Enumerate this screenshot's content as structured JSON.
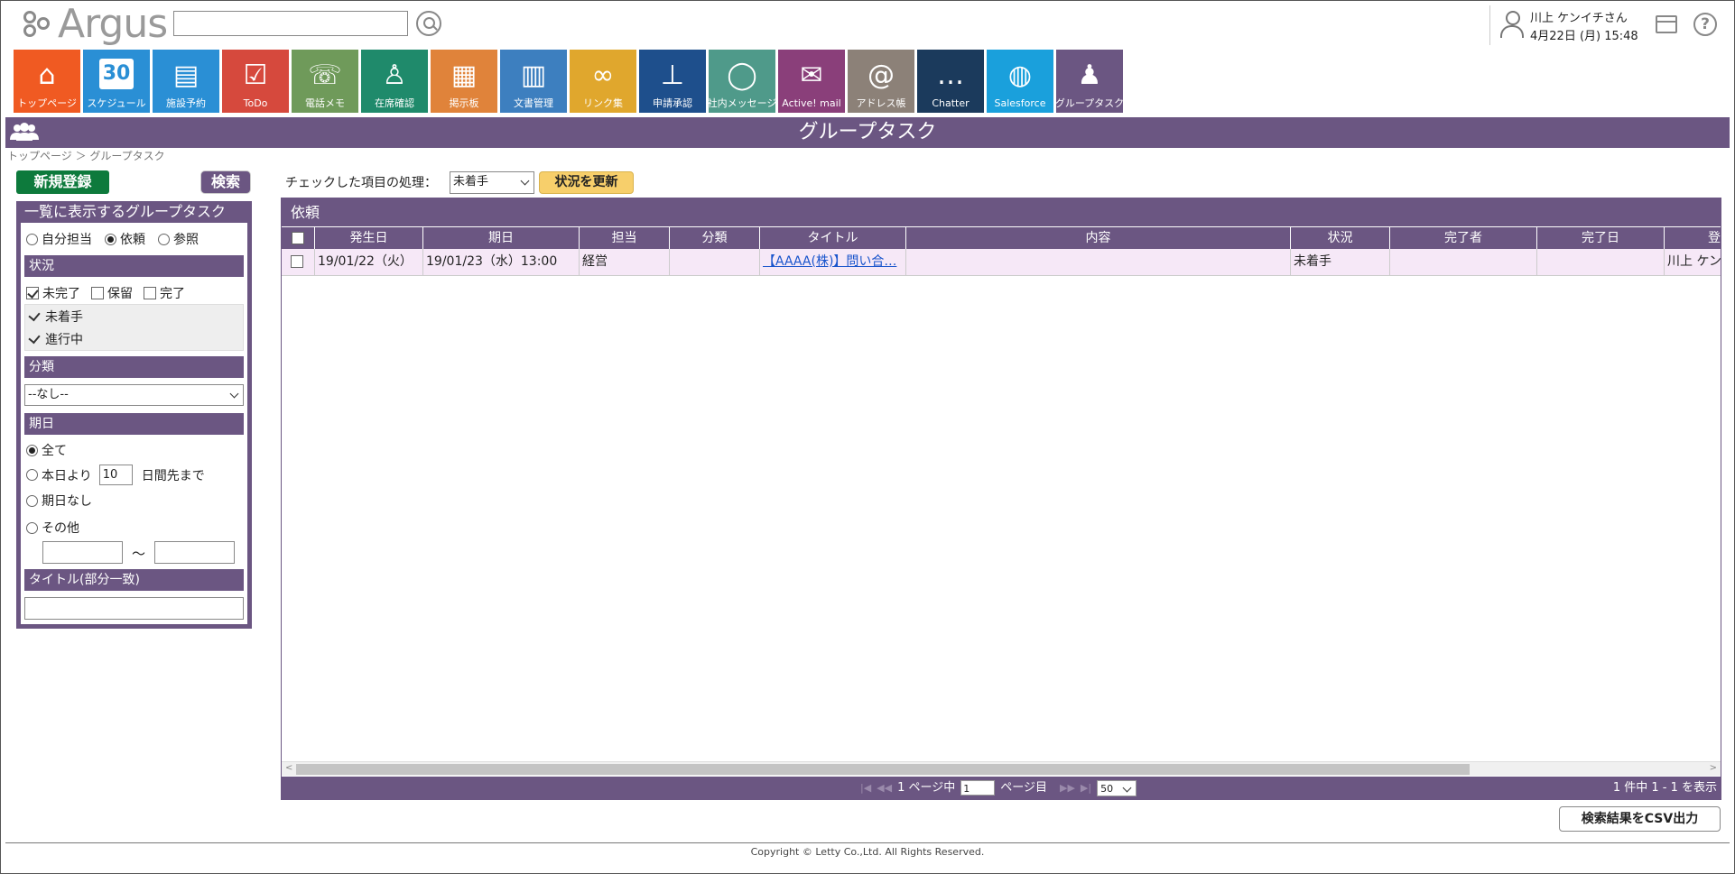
{
  "header": {
    "logo_text": "Argus",
    "search_value": "",
    "user_name": "川上 ケンイチさん",
    "user_datetime": "4月22日 (月) 15:48"
  },
  "apps": [
    {
      "label": "トップページ",
      "icon": "home-icon",
      "color": "#f05a22"
    },
    {
      "label": "スケジュール",
      "icon": "calendar-icon",
      "color": "#2a8fd5",
      "glyph": "30"
    },
    {
      "label": "施設予約",
      "icon": "facility-icon",
      "color": "#2a8fd5"
    },
    {
      "label": "ToDo",
      "icon": "todo-icon",
      "color": "#d6493d"
    },
    {
      "label": "電話メモ",
      "icon": "phone-icon",
      "color": "#6f9a5a"
    },
    {
      "label": "在席確認",
      "icon": "presence-icon",
      "color": "#1f8a6b"
    },
    {
      "label": "掲示板",
      "icon": "board-icon",
      "color": "#e0833a"
    },
    {
      "label": "文書管理",
      "icon": "documents-icon",
      "color": "#3d7fbf"
    },
    {
      "label": "リンク集",
      "icon": "link-icon",
      "color": "#e0a72d"
    },
    {
      "label": "申請承認",
      "icon": "stamp-icon",
      "color": "#1e4f8c"
    },
    {
      "label": "社内メッセージ",
      "icon": "message-icon",
      "color": "#4f9a8a"
    },
    {
      "label": "Active! mail",
      "icon": "mail-icon",
      "color": "#8a3f7a"
    },
    {
      "label": "アドレス帳",
      "icon": "address-book-icon",
      "color": "#8c8178"
    },
    {
      "label": "Chatter",
      "icon": "chatter-icon",
      "color": "#1b3a5c"
    },
    {
      "label": "Salesforce",
      "icon": "globe-icon",
      "color": "#1aa0dc"
    },
    {
      "label": "グループタスク",
      "icon": "group-task-icon",
      "color": "#6b5682"
    }
  ],
  "page": {
    "title": "グループタスク",
    "breadcrumb": "トップページ ＞ グループタスク"
  },
  "left": {
    "new_button": "新規登録",
    "search_button": "検索",
    "panel_title": "一覧に表示するグループタスク",
    "scope": [
      {
        "label": "自分担当",
        "selected": false
      },
      {
        "label": "依頼",
        "selected": true
      },
      {
        "label": "参照",
        "selected": false
      }
    ],
    "status_heading": "状況",
    "status_checks": [
      {
        "label": "未完了",
        "checked": true
      },
      {
        "label": "保留",
        "checked": false
      },
      {
        "label": "完了",
        "checked": false
      }
    ],
    "sub_status": [
      "未着手",
      "進行中"
    ],
    "category_heading": "分類",
    "category_value": "--なし--",
    "due_heading": "期日",
    "due_all": "全て",
    "due_from_today": "本日より",
    "due_days": "10",
    "due_days_suffix": "日間先まで",
    "due_none": "期日なし",
    "due_other": "その他",
    "range_sep": "～",
    "title_heading": "タイトル(部分一致)"
  },
  "main": {
    "batch_label": "チェックした項目の処理：",
    "batch_value": "未着手",
    "update_button": "状況を更新",
    "grid_title": "依頼",
    "columns": [
      "",
      "発生日",
      "期日",
      "担当",
      "分類",
      "タイトル",
      "内容",
      "状況",
      "完了者",
      "完了日",
      "登"
    ],
    "rows": [
      {
        "occurred": "19/01/22（火）",
        "due": "19/01/23（水）13:00",
        "assignee": "経営",
        "category": "",
        "title": "【AAAA(株)】問い合…",
        "content": "",
        "status": "未着手",
        "completed_by": "",
        "completed_on": "",
        "registrant": "川上 ケン"
      }
    ],
    "pager": {
      "first": "|◀",
      "prev": "◀◀",
      "total_pages_text": "1 ページ中",
      "page_value": "1",
      "page_suffix": "ページ目",
      "next": "▶▶",
      "last": "▶|",
      "per_page": "50",
      "summary": "1 件中 1 - 1 を表示"
    },
    "csv_button": "検索結果をCSV出力"
  },
  "footer": {
    "copyright": "Copyright © Letty Co.,Ltd. All Rights Reserved."
  }
}
